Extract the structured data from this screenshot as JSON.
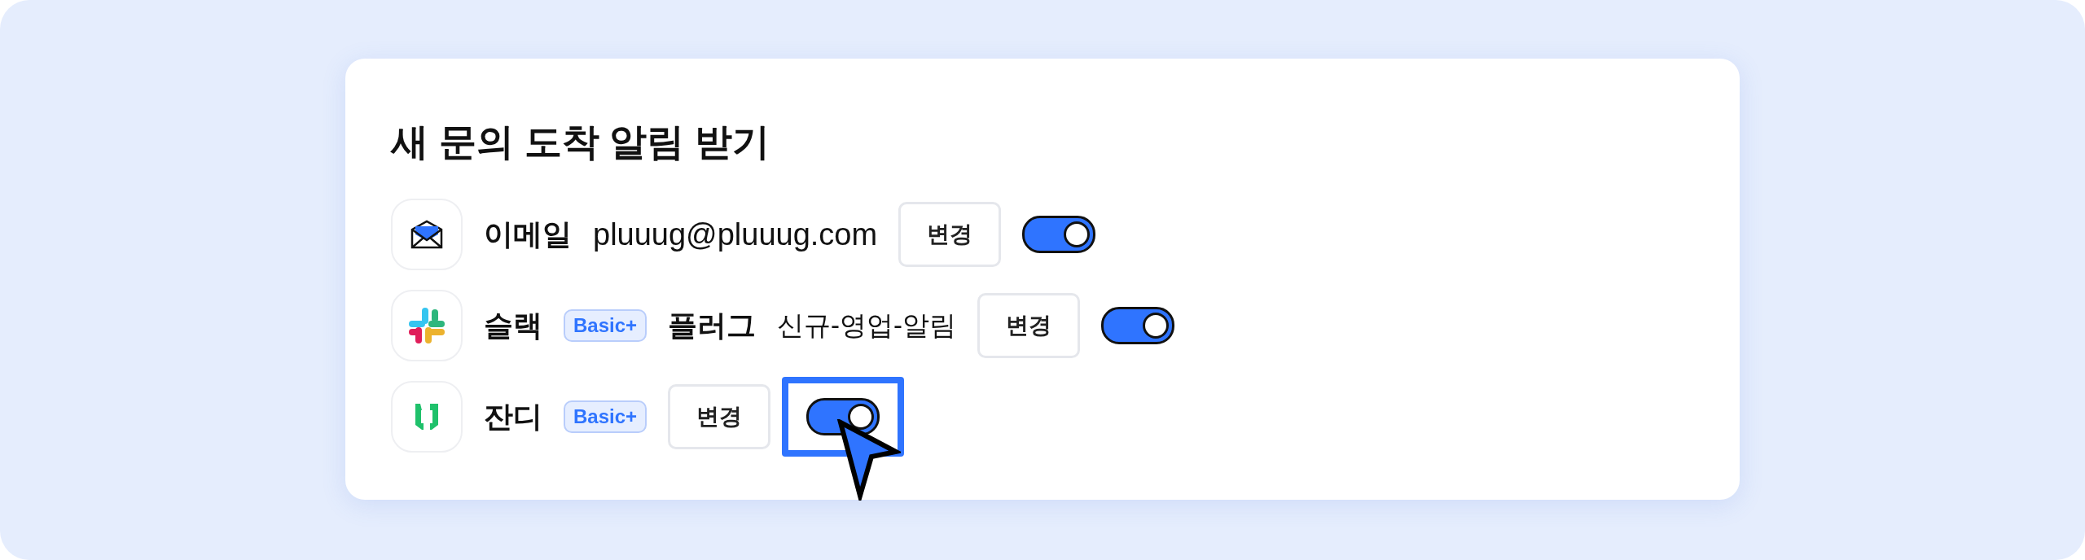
{
  "card": {
    "title": "새 문의 도착 알림 받기"
  },
  "channels": [
    {
      "kind": "email",
      "label": "이메일",
      "value": "pluuug@pluuug.com",
      "button": "변경",
      "on": true,
      "focused": false
    },
    {
      "kind": "slack",
      "label": "슬랙",
      "badge": "Basic+",
      "workspace": "플러그",
      "value": "신규-영업-알림",
      "button": "변경",
      "on": true,
      "focused": false
    },
    {
      "kind": "jandi",
      "label": "잔디",
      "badge": "Basic+",
      "button": "변경",
      "on": true,
      "focused": true
    }
  ]
}
